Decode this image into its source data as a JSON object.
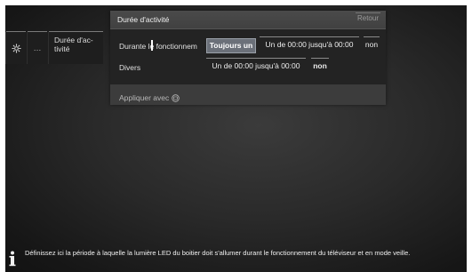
{
  "breadcrumb": {
    "dots": "…",
    "current": "Durée d'ac-tivité"
  },
  "dialog": {
    "title": "Durée d'activité",
    "back_label": "Retour",
    "rows": [
      {
        "label": "Durante le fonctionnem",
        "options": [
          "Toujours un",
          "Un de 00:00 jusqu'à 00:00",
          "non"
        ],
        "selected": "Toujours un"
      },
      {
        "label": "Divers",
        "options": [
          "Un de 00:00 jusqu'à 00:00",
          "non"
        ],
        "selected": ""
      }
    ],
    "apply_label": "Appliquer avec"
  },
  "info": {
    "icon": "info-icon",
    "text": "Définissez ici la période à laquelle la lumière LED du boitier doit s'allumer durant le fonctionnement du téléviseur et en mode veille."
  },
  "colors": {
    "background": "#2a2a2a",
    "panel": "#3c3c3c",
    "content": "#232323",
    "selected": "#6b7079"
  }
}
